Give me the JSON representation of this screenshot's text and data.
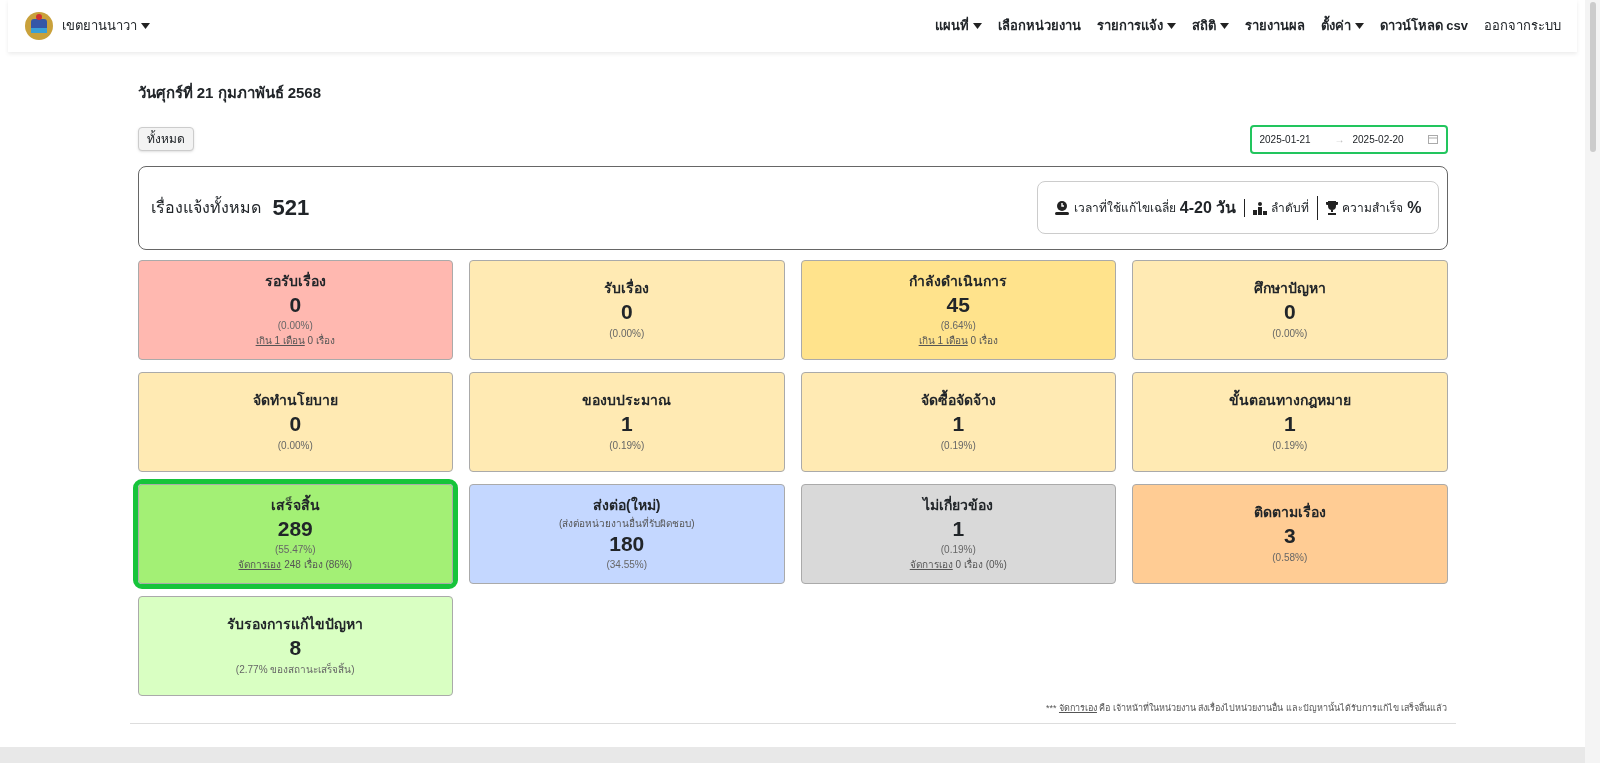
{
  "navbar": {
    "brand": "เขตยานนาวา",
    "menu": [
      {
        "label": "แผนที่",
        "dropdown": true,
        "bold": true
      },
      {
        "label": "เลือกหน่วยงาน",
        "dropdown": false,
        "bold": true
      },
      {
        "label": "รายการแจ้ง",
        "dropdown": true,
        "bold": true
      },
      {
        "label": "สถิติ",
        "dropdown": true,
        "bold": true
      },
      {
        "label": "รายงานผล",
        "dropdown": false,
        "bold": true
      },
      {
        "label": "ตั้งค่า",
        "dropdown": true,
        "bold": true
      },
      {
        "label": "ดาวน์โหลด csv",
        "dropdown": false,
        "bold": true
      },
      {
        "label": "ออกจากระบบ",
        "dropdown": false,
        "bold": false
      }
    ]
  },
  "date_heading": "วันศุกร์ที่ 21 กุมภาพันธ์ 2568",
  "filter_button": "ทั้งหมด",
  "date_range": {
    "start": "2025-01-21",
    "separator": "→",
    "end": "2025-02-20",
    "focused": true
  },
  "summary": {
    "label": "เรื่องแจ้งทั้งหมด",
    "total": "521",
    "stats": [
      {
        "kind": "time",
        "label": "เวลาที่ใช้แก้ไขเฉลี่ย",
        "value": "4-20 วัน"
      },
      {
        "kind": "rank",
        "label": "ลำดับที่"
      },
      {
        "kind": "success",
        "label": "ความสำเร็จ",
        "value": "%"
      }
    ]
  },
  "cards": [
    {
      "title": "รอรับเรื่อง",
      "count": "0",
      "percent": "(0.00%)",
      "note": {
        "link": "เกิน 1 เดือน",
        "text": "0 เรื่อง"
      },
      "color": "#ffb8b0",
      "selected": false
    },
    {
      "title": "รับเรื่อง",
      "count": "0",
      "percent": "(0.00%)",
      "color": "#ffeab3",
      "selected": false
    },
    {
      "title": "กำลังดำเนินการ",
      "count": "45",
      "percent": "(8.64%)",
      "note": {
        "link": "เกิน 1 เดือน",
        "text": "0 เรื่อง"
      },
      "color": "#ffe38c",
      "selected": false
    },
    {
      "title": "ศึกษาปัญหา",
      "count": "0",
      "percent": "(0.00%)",
      "color": "#ffeab3",
      "selected": false
    },
    {
      "title": "จัดทำนโยบาย",
      "count": "0",
      "percent": "(0.00%)",
      "color": "#ffeab3",
      "selected": false
    },
    {
      "title": "ของบประมาณ",
      "count": "1",
      "percent": "(0.19%)",
      "color": "#ffeab3",
      "selected": false
    },
    {
      "title": "จัดซื้อจัดจ้าง",
      "count": "1",
      "percent": "(0.19%)",
      "color": "#ffeab3",
      "selected": false
    },
    {
      "title": "ขั้นตอนทางกฎหมาย",
      "count": "1",
      "percent": "(0.19%)",
      "color": "#ffeab3",
      "selected": false
    },
    {
      "title": "เสร็จสิ้น",
      "count": "289",
      "percent": "(55.47%)",
      "note": {
        "link": "จัดการเอง",
        "text": "248 เรื่อง (86%)"
      },
      "color": "#a3f075",
      "selected": true
    },
    {
      "title": "ส่งต่อ(ใหม่)",
      "subtitle": "(ส่งต่อหน่วยงานอื่นที่รับผิดชอบ)",
      "count": "180",
      "percent": "(34.55%)",
      "color": "#c4d7ff",
      "selected": false
    },
    {
      "title": "ไม่เกี่ยวข้อง",
      "count": "1",
      "percent": "(0.19%)",
      "note": {
        "link": "จัดการเอง",
        "text": "0 เรื่อง (0%)"
      },
      "color": "#d9d9d9",
      "selected": false
    },
    {
      "title": "ติดตามเรื่อง",
      "count": "3",
      "percent": "(0.58%)",
      "color": "#ffcc94",
      "selected": false
    },
    {
      "title": "รับรองการแก้ไขปัญหา",
      "count": "8",
      "percent": "(2.77% ของสถานะเสร็จสิ้น)",
      "color": "#d9ffc2",
      "selected": false
    }
  ],
  "footnote": {
    "prefix": "***",
    "link": "จัดการเอง",
    "text": "คือ เจ้าหน้าที่ในหน่วยงาน ส่งเรื่องไปหน่วยงานอื่น และปัญหานั้นได้รับการแก้ไข เสร็จสิ้นแล้ว"
  }
}
